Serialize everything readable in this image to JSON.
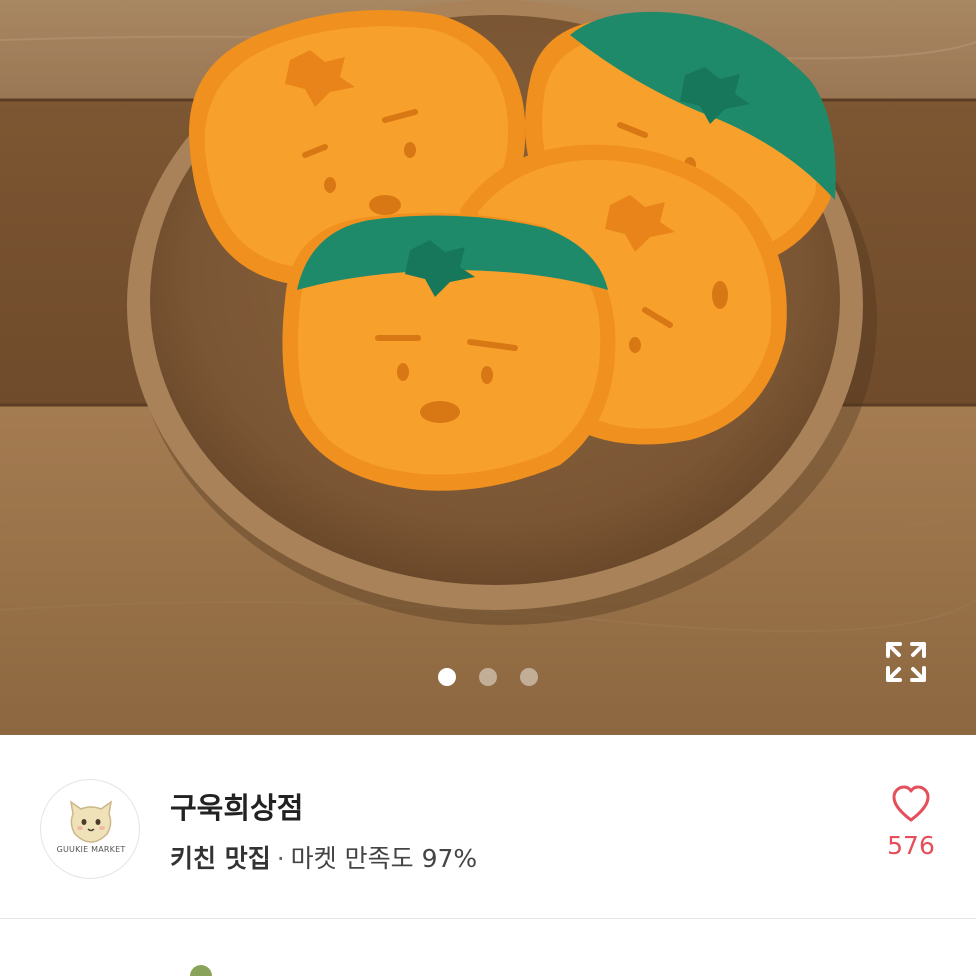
{
  "product": {
    "image_alt": "persimmon cookies on wooden plate",
    "carousel": {
      "count": 3,
      "active_index": 0
    },
    "icons": {
      "expand": "expand-icon"
    }
  },
  "seller": {
    "avatar_caption": "GUUKIE MARKET",
    "name": "구욱희상점",
    "badge": "키친 맛집",
    "separator": "·",
    "satisfaction": "마켓 만족도 97%",
    "likes": "576",
    "icons": {
      "like": "heart-outline-icon"
    },
    "colors": {
      "like": "#e54e5b"
    }
  }
}
